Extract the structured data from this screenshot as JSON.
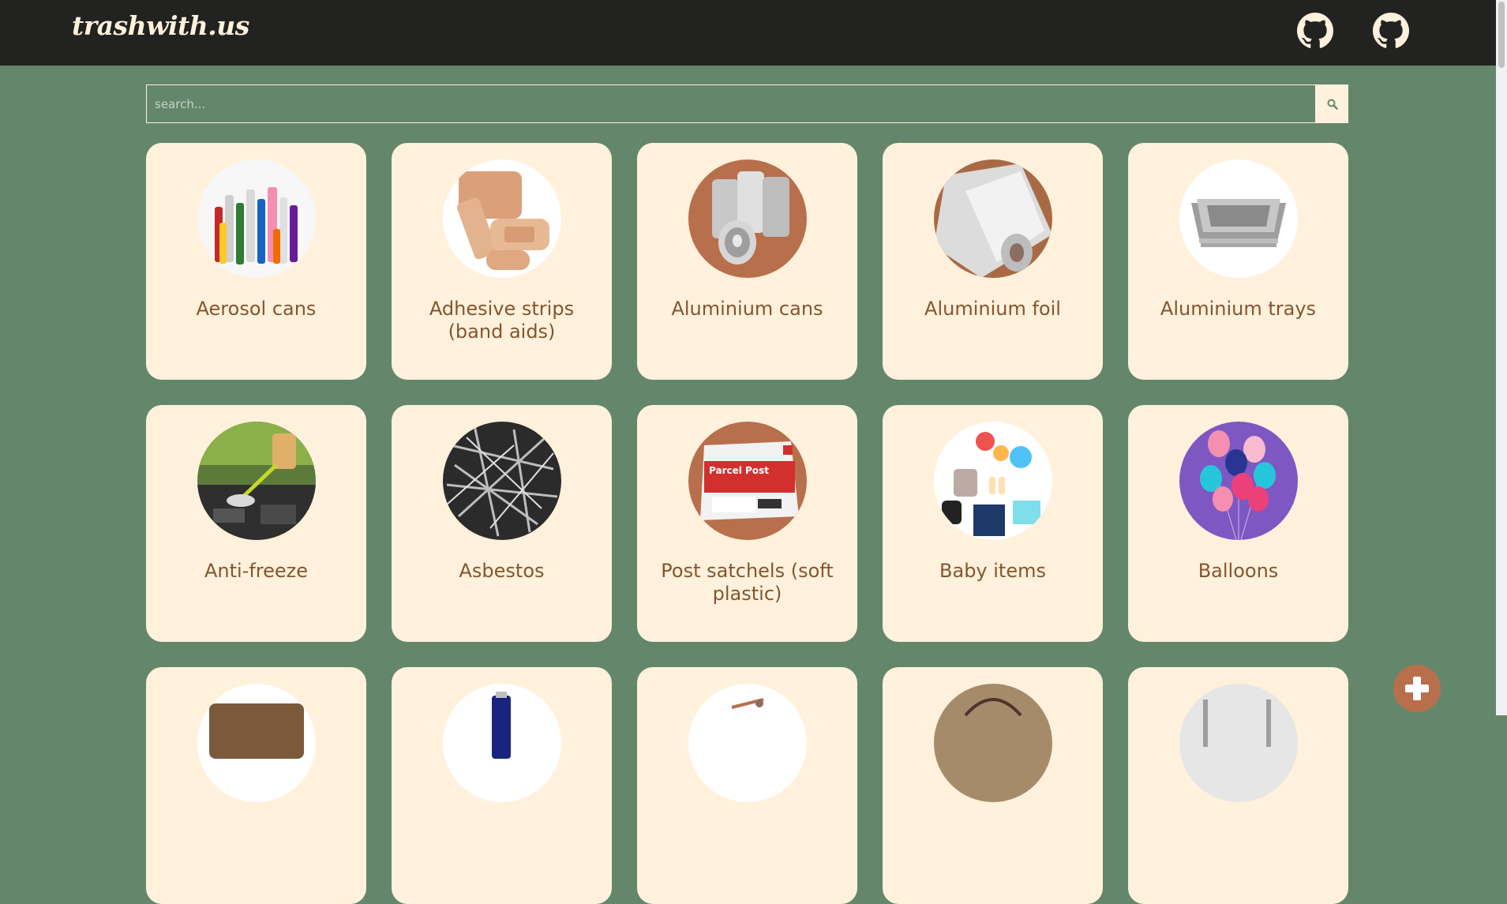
{
  "header": {
    "brand": "trashwith.us",
    "links": [
      {
        "icon": "github-icon"
      },
      {
        "icon": "github-icon"
      }
    ]
  },
  "search": {
    "placeholder": "search...",
    "value": "",
    "button_icon": "search-icon"
  },
  "items": [
    {
      "label": "Aerosol cans"
    },
    {
      "label": "Adhesive strips (band aids)"
    },
    {
      "label": "Aluminium cans"
    },
    {
      "label": "Aluminium foil"
    },
    {
      "label": "Aluminium trays"
    },
    {
      "label": "Anti-freeze"
    },
    {
      "label": "Asbestos"
    },
    {
      "label": "Post satchels (soft plastic)"
    },
    {
      "label": "Baby items"
    },
    {
      "label": "Balloons"
    }
  ],
  "parcel_text": "Parcel Post",
  "fab": {
    "icon": "plus-icon"
  },
  "colors": {
    "background": "#64876b",
    "topbar": "#222220",
    "card": "#fff1dc",
    "label": "#84552f",
    "fab": "#b86f4c"
  }
}
